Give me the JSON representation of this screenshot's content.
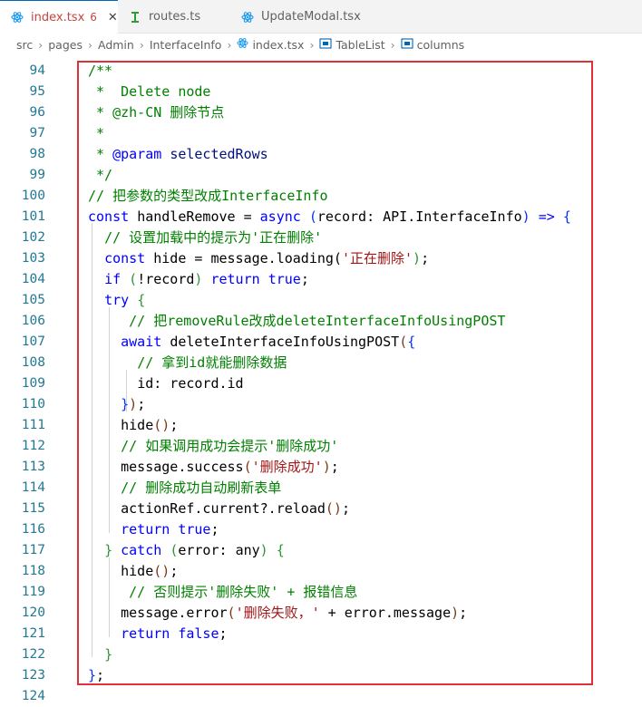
{
  "tabs": [
    {
      "label": "index.tsx",
      "count": "6",
      "active": true,
      "close": "✕"
    },
    {
      "label": "routes.ts",
      "active": false
    },
    {
      "label": "UpdateModal.tsx",
      "active": false
    }
  ],
  "breadcrumb": [
    "src",
    "pages",
    "Admin",
    "InterfaceInfo",
    "index.tsx",
    "TableList",
    "columns"
  ],
  "line_numbers": [
    "94",
    "95",
    "96",
    "97",
    "98",
    "99",
    "100",
    "101",
    "102",
    "103",
    "104",
    "105",
    "106",
    "107",
    "108",
    "109",
    "110",
    "111",
    "112",
    "113",
    "114",
    "115",
    "116",
    "117",
    "118",
    "119",
    "120",
    "121",
    "122",
    "123",
    "124"
  ],
  "code": {
    "l94": "/**",
    "l95": " *  Delete node",
    "l96": " * @zh-CN 删除节点",
    "l97": " *",
    "l98_tag": "@param",
    "l98_name": "selectedRows",
    "l99": " */",
    "l100": "// 把参数的类型改成InterfaceInfo",
    "l101_const": "const",
    "l101_name": "handleRemove",
    "l101_async": "async",
    "l101_param": "record",
    "l101_type": "API.InterfaceInfo",
    "l102": "// 设置加载中的提示为'正在删除'",
    "l103_const": "const",
    "l103_rest": "hide = message.loading(",
    "l103_str": "'正在删除'",
    "l104_if": "if",
    "l104_rec": "!record",
    "l104_return": "return",
    "l104_true": "true",
    "l105_try": "try",
    "l106": "// 把removeRule改成deleteInterfaceInfoUsingPOST",
    "l107_await": "await",
    "l107_fn": "deleteInterfaceInfoUsingPOST",
    "l108": "// 拿到id就能删除数据",
    "l109": "id: record.id",
    "l111": "hide",
    "l112": "// 如果调用成功会提示'删除成功'",
    "l113_fn": "message.success",
    "l113_str": "'删除成功'",
    "l114": "// 删除成功自动刷新表单",
    "l115": "actionRef.current?.reload",
    "l116_return": "return",
    "l116_true": "true",
    "l117_catch": "catch",
    "l117_err": "error",
    "l117_any": "any",
    "l118": "hide",
    "l119": "// 否则提示'删除失败' + 报错信息",
    "l120_fn": "message.error",
    "l120_str": "'删除失败，'",
    "l120_rest": " + error.message",
    "l121_return": "return",
    "l121_false": "false"
  },
  "colors": {
    "comment": "#008000",
    "keyword": "#0000ff",
    "string": "#a31515",
    "highlight_box": "#e0313a",
    "line_number": "#237893"
  }
}
